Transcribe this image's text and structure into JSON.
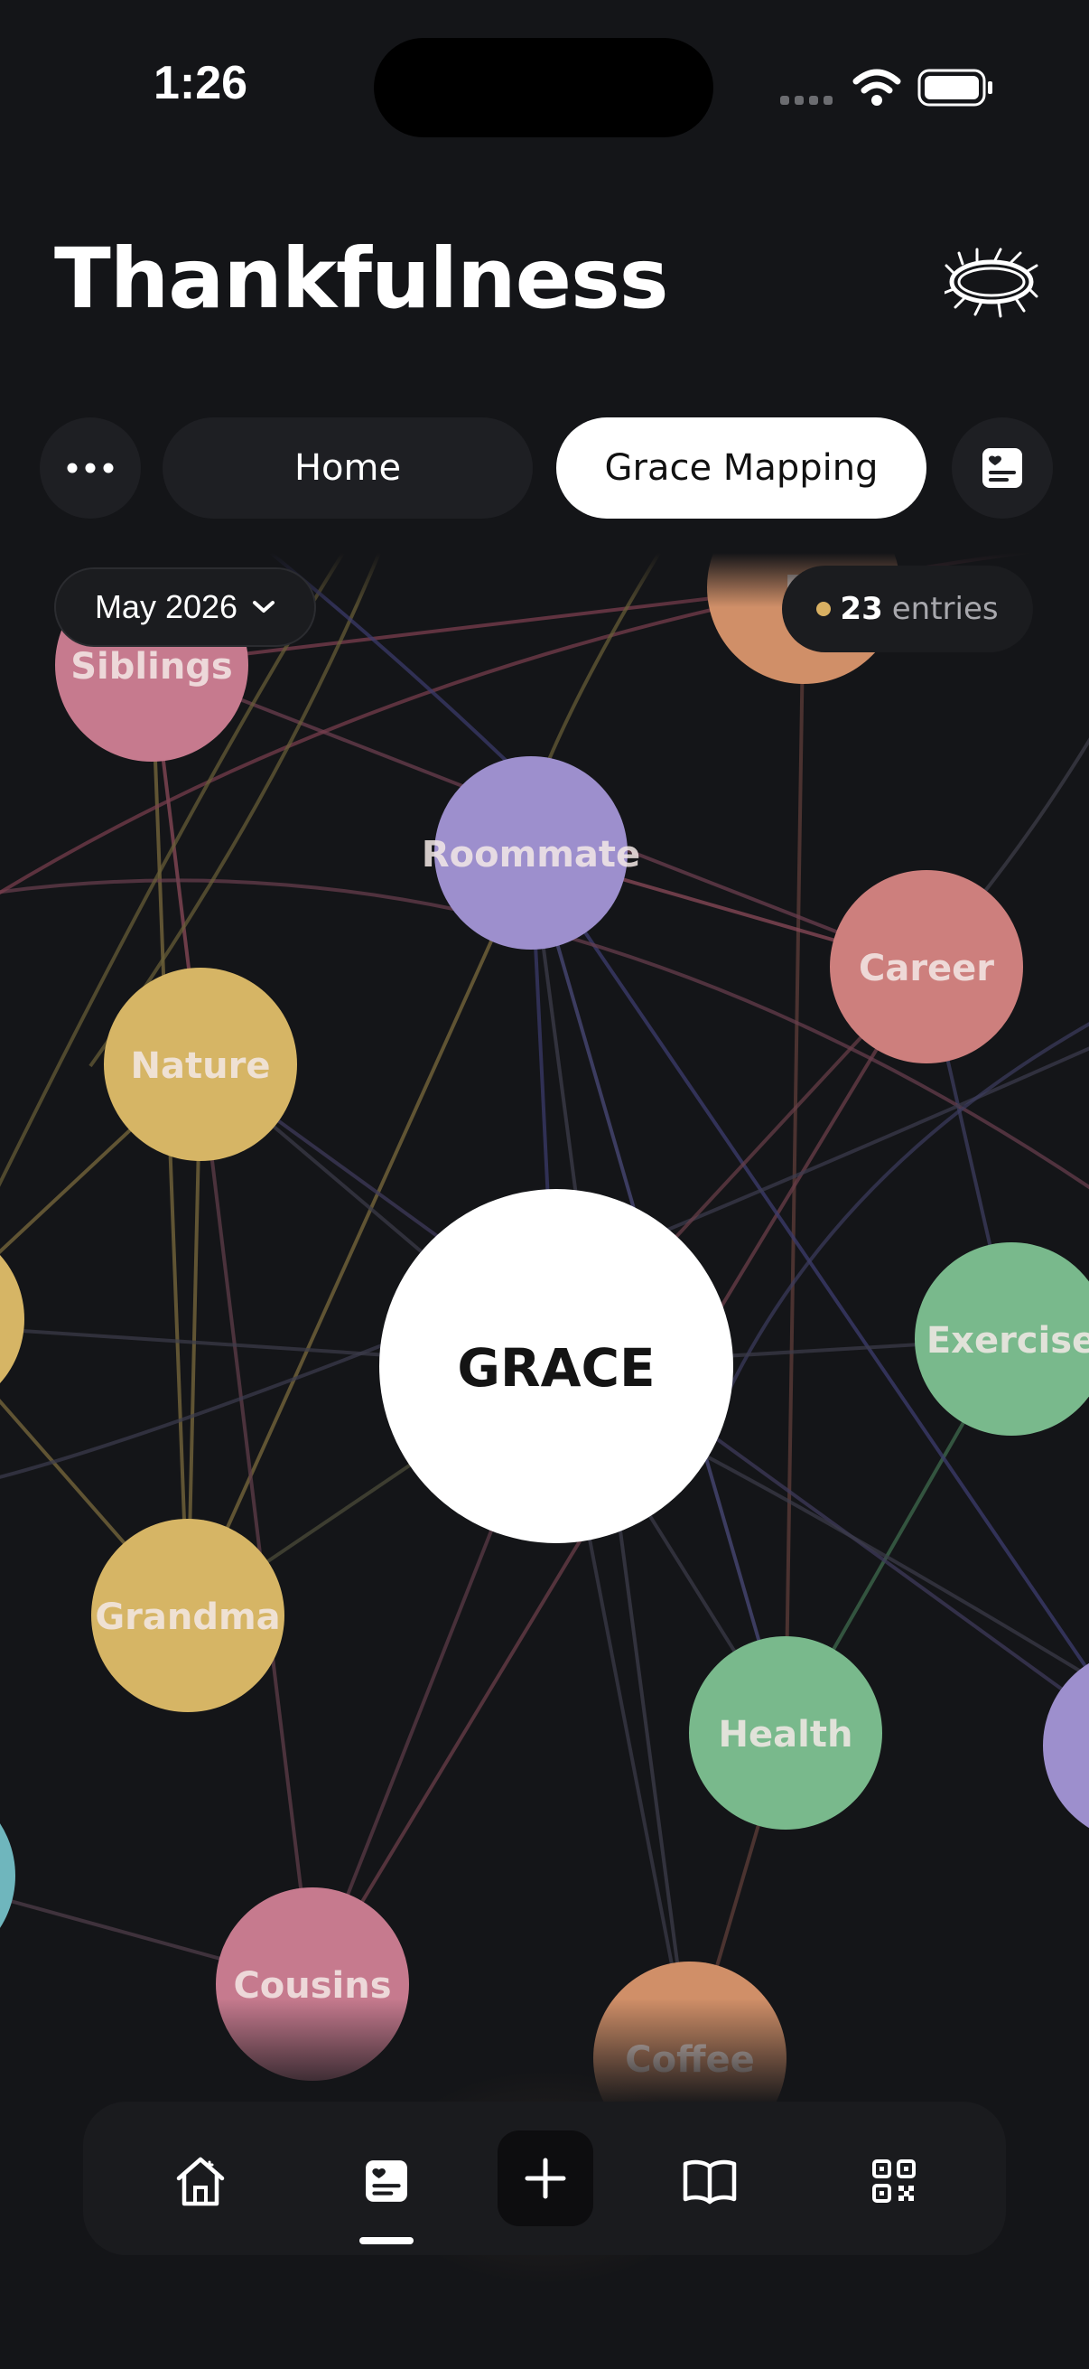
{
  "status_bar": {
    "time": "1:26",
    "icons": [
      "signal-icon",
      "wifi-icon",
      "battery-icon"
    ]
  },
  "header": {
    "title": "Thankfulness",
    "icon": "crown-of-thorns-icon"
  },
  "tabs": {
    "more_icon": "more-dots-icon",
    "items": [
      "Home",
      "Grace Mapping"
    ],
    "active": "Grace Mapping",
    "journal_icon": "journal-heart-icon"
  },
  "filters": {
    "month": "May 2026",
    "entries_count": "23",
    "entries_label": "entries"
  },
  "graph": {
    "center_label": "GRACE",
    "nodes": [
      {
        "label": "Siblings",
        "color": "#c67a8e"
      },
      {
        "label": "Pi",
        "color": "#d08f68"
      },
      {
        "label": "Roommate",
        "color": "#9d8fcd"
      },
      {
        "label": "Career",
        "color": "#cd7f7d"
      },
      {
        "label": "Nature",
        "color": "#d6b565"
      },
      {
        "label": "Exercise",
        "color": "#79b98c"
      },
      {
        "label": "Grandma",
        "color": "#d6b565"
      },
      {
        "label": "Health",
        "color": "#79b98c"
      },
      {
        "label": "Cousins",
        "color": "#c67a8e"
      },
      {
        "label": "Coffee",
        "color": "#d08f68"
      },
      {
        "label": "",
        "color": "#d6b565"
      },
      {
        "label": "",
        "color": "#9d8fcd"
      },
      {
        "label": "",
        "color": "#6fb6bd"
      }
    ]
  },
  "bottom_nav": {
    "items": [
      "home-icon",
      "journal-icon",
      "add-icon",
      "book-icon",
      "qr-code-icon"
    ],
    "active": "journal-icon"
  },
  "colors": {
    "background": "#141518",
    "surface": "#1e1f23",
    "accent_gold": "#d9b062"
  }
}
